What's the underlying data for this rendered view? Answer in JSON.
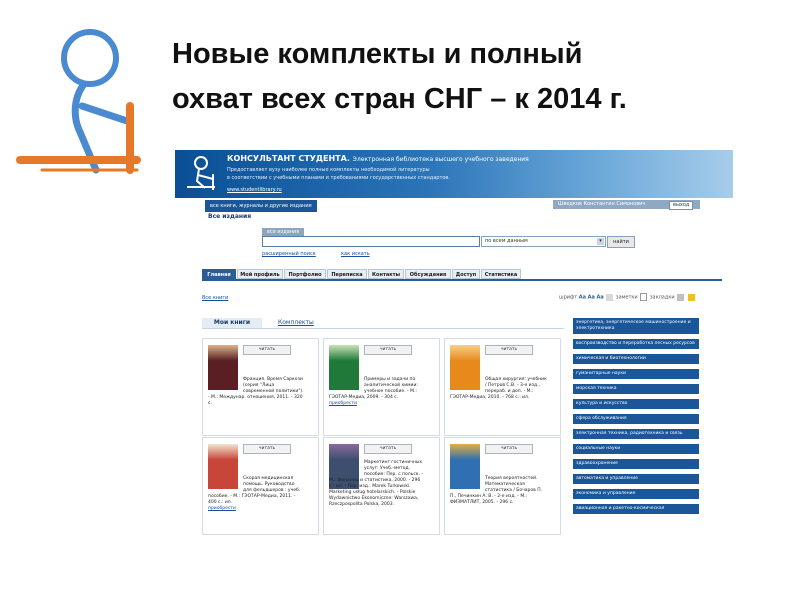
{
  "slide": {
    "title_lines": [
      "Новые комплекты и полный",
      "охват всех стран СНГ – к 2014 г."
    ]
  },
  "site": {
    "brand": "КОНСУЛЬТАНТ СТУДЕНТА.",
    "tagline": "Электронная библиотека высшего учебного заведения",
    "desc_line1": "Предоставляет вузу наиболее полные комплекты необходимой литературы",
    "desc_line2": "в соответствии с учебными планами и требованиями государственных стандартов.",
    "url": "www.studentlibrary.ru"
  },
  "topbar": {
    "scope_tab": "все книги, журналы и другие издания",
    "user_name": "Шведков Константин Симонович",
    "logout": "выход"
  },
  "page_title": "Все издания",
  "search": {
    "tab": "все издания",
    "query": "",
    "scope_value": "по всем данным",
    "button": "найти",
    "advanced_link": "расширенный поиск",
    "how_link": "как искать"
  },
  "nav_tabs": [
    {
      "label": "Главная",
      "active": true
    },
    {
      "label": "Мой профиль",
      "active": false
    },
    {
      "label": "Портфолио",
      "active": false
    },
    {
      "label": "Переписка",
      "active": false
    },
    {
      "label": "Контакты",
      "active": false
    },
    {
      "label": "Обсуждения",
      "active": false
    },
    {
      "label": "Доступ",
      "active": false
    },
    {
      "label": "Статистика",
      "active": false
    }
  ],
  "breadcrumb": "Все книги",
  "tools": {
    "font_label": "шрифт",
    "font_icons": [
      "Aa",
      "Aa",
      "Aa"
    ],
    "notes_label": "заметки",
    "bookmarks_label": "закладки"
  },
  "my_tabs": {
    "active": "Мои книги",
    "link": "Комплекты"
  },
  "read_label": "читать",
  "books": [
    {
      "lines": [
        "Франция. Время Саркози",
        "(серия \"Лица",
        "современной политики\").",
        "- М.: Междунар. отношения, 2011. - 320",
        "с."
      ],
      "link": "",
      "cover": "#5a1f22",
      "cover_accent": "#d9b38c"
    },
    {
      "lines": [
        "Примеры и задачи по",
        "аналитической химии:",
        "учебное пособие. - М.:",
        "ГЭОТАР-Медиа, 2009. - 304 с."
      ],
      "link": "приобрести",
      "cover": "#1f7a3a",
      "cover_accent": "#c9e3b4"
    },
    {
      "lines": [
        "Общая хирургия: учебник",
        "/ Петров С.В. - 3-е изд.,",
        "перераб. и доп. - М.:",
        "ГЭОТАР-Медиа, 2010. - 768 с.: ил."
      ],
      "link": "",
      "cover": "#e8891c",
      "cover_accent": "#f6d08a"
    },
    {
      "lines": [
        "Скорая медицинская",
        "помощь. Руководство",
        "для фельдшеров : учеб.",
        "пособие. - М.: ГЭОТАР-Медиа, 2011. -",
        "400 с.: ил."
      ],
      "link": "приобрести",
      "cover": "#c8453a",
      "cover_accent": "#f2e6d0"
    },
    {
      "lines": [
        "Маркетинг гостиничных",
        "услуг: Учеб.-метод.",
        "пособие: Пер. с польск. -",
        "М.: Финансы и статистика, 2000. - 296",
        "с.: ил. - Пер. изд.: Marek Turkowski.",
        "Marketing usług hotelarskich. - Polskie",
        "Wydawnictwo Ekonomiczne: Warszawa,",
        "Rzeczpospolita Polska, 2003."
      ],
      "link": "",
      "cover": "#3c4f6e",
      "cover_accent": "#8a6a9c"
    },
    {
      "lines": [
        "Теория вероятностей.",
        "Математическая",
        "статистика / Бочаров П.",
        "П., Печинкин А. В. - 2-е изд. - М.:",
        "ФИЗМАТЛИТ, 2005. - 296 с."
      ],
      "link": "",
      "cover": "#2f6fb2",
      "cover_accent": "#e0b040"
    }
  ],
  "categories": [
    "энергетика, энергетическое машиностроение и электротехника",
    "воспроизводство и переработка лесных ресурсов",
    "химическая и биотехнологии",
    "гуманитарные науки",
    "морская техника",
    "культура и искусство",
    "сфера обслуживания",
    "электронная техника, радиотехника и связь",
    "социальные науки",
    "здравоохранение",
    "автоматика и управление",
    "экономика и управление",
    "авиационная и ракетно-космическая"
  ],
  "colors": {
    "brand_blue": "#1a5698",
    "nav_active": "#2a5d96",
    "logo_orange": "#e6782a",
    "logo_blue": "#4a8ad0"
  }
}
